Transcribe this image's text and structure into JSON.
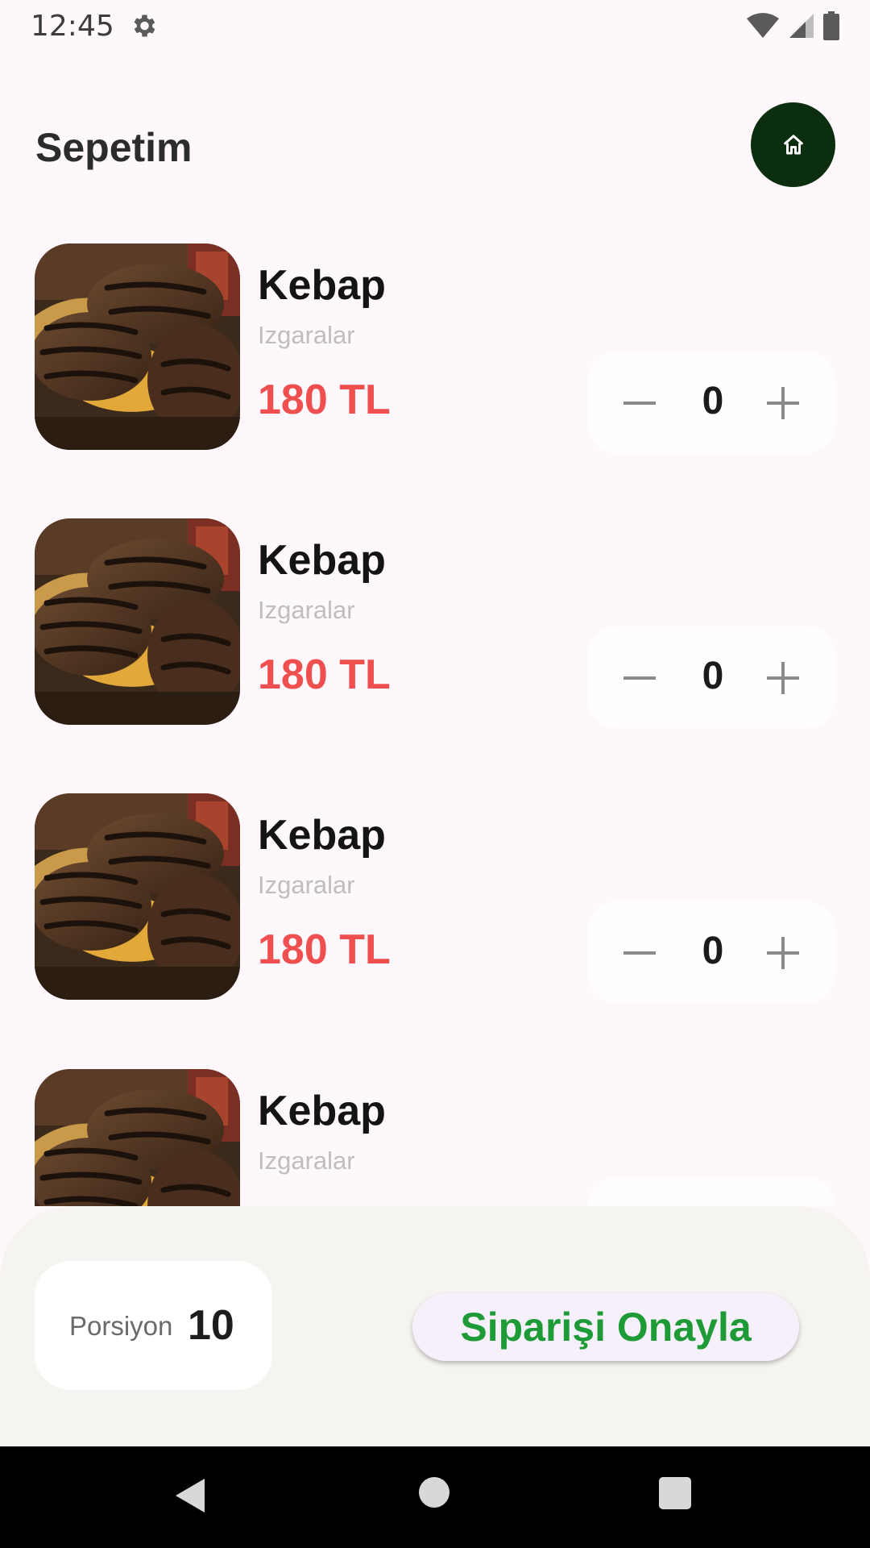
{
  "status_bar": {
    "time": "12:45",
    "icons": [
      "gear-icon",
      "wifi-icon",
      "cellular-signal-icon",
      "battery-icon"
    ]
  },
  "header": {
    "title": "Sepetim",
    "home_icon": "home-icon",
    "accent_color": "#0a2e0e"
  },
  "cart": {
    "items": [
      {
        "name": "Kebap",
        "category": "Izgaralar",
        "price": "180 TL",
        "quantity": "0"
      },
      {
        "name": "Kebap",
        "category": "Izgaralar",
        "price": "180 TL",
        "quantity": "0"
      },
      {
        "name": "Kebap",
        "category": "Izgaralar",
        "price": "180 TL",
        "quantity": "0"
      },
      {
        "name": "Kebap",
        "category": "Izgaralar",
        "price": "",
        "quantity": ""
      }
    ],
    "price_color": "#ef4f4f"
  },
  "footer": {
    "portion_label": "Porsiyon",
    "portion_value": "10",
    "confirm_label": "Siparişi Onayla",
    "confirm_color": "#1e9a37"
  },
  "nav_bar": {
    "icons": [
      "back-icon",
      "home-circle-icon",
      "recents-icon"
    ]
  }
}
